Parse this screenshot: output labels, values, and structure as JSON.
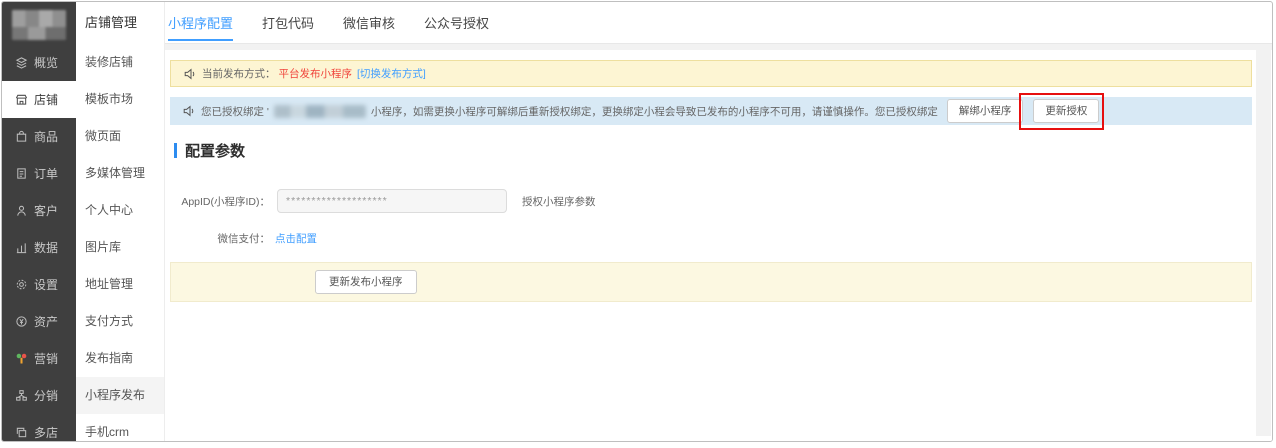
{
  "nav_primary": {
    "items": [
      {
        "label": "概览"
      },
      {
        "label": "店铺"
      },
      {
        "label": "商品"
      },
      {
        "label": "订单"
      },
      {
        "label": "客户"
      },
      {
        "label": "数据"
      },
      {
        "label": "设置"
      },
      {
        "label": "资产"
      },
      {
        "label": "营销"
      },
      {
        "label": "分销"
      },
      {
        "label": "多店"
      }
    ],
    "active": "店铺"
  },
  "nav_secondary": {
    "title": "店铺管理",
    "items": [
      {
        "label": "装修店铺"
      },
      {
        "label": "模板市场"
      },
      {
        "label": "微页面"
      },
      {
        "label": "多媒体管理"
      },
      {
        "label": "个人中心"
      },
      {
        "label": "图片库"
      },
      {
        "label": "地址管理"
      },
      {
        "label": "支付方式"
      },
      {
        "label": "发布指南"
      },
      {
        "label": "小程序发布"
      },
      {
        "label": "手机crm"
      }
    ],
    "active": "小程序发布"
  },
  "tabs": {
    "items": [
      {
        "label": "小程序配置"
      },
      {
        "label": "打包代码"
      },
      {
        "label": "微信审核"
      },
      {
        "label": "公众号授权"
      }
    ],
    "active": "小程序配置"
  },
  "notice_publish": {
    "label": "当前发布方式：",
    "value": "平台发布小程序",
    "link": "[切换发布方式]"
  },
  "notice_bind": {
    "text_before": "您已授权绑定 '",
    "text_after": "小程序，如需更换小程序可解绑后重新授权绑定，更换绑定小程会导致已发布的小程序不可用，请谨慎操作。您已授权绑定",
    "unbind_button": "解绑小程序",
    "update_button": "更新授权"
  },
  "config": {
    "section_title": "配置参数",
    "appid_label": "AppID(小程序ID)：",
    "appid_value": "********************",
    "appid_hint": "授权小程序参数",
    "pay_label": "微信支付：",
    "pay_link": "点击配置"
  },
  "footer": {
    "publish_button": "更新发布小程序"
  },
  "colors": {
    "sidebar_dark": "#3f3f3f",
    "accent_blue": "#409eff",
    "danger_red": "#f0443b",
    "notice_yellow_bg": "#fdf5d3",
    "notice_yellow_border": "#eedf9e",
    "notice_blue_bg": "#d8e9f5",
    "annotation_red": "#e60f0f"
  }
}
